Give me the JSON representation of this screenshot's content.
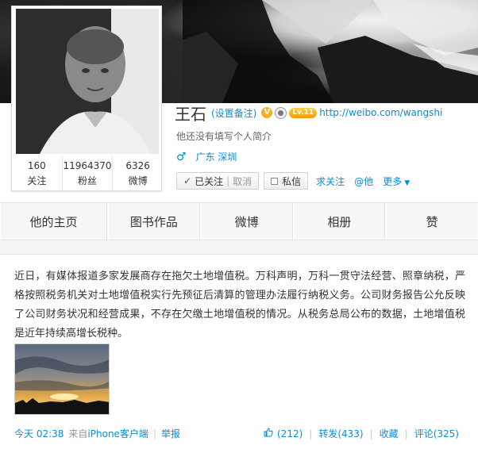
{
  "profile": {
    "name": "王石",
    "remark": "(设置备注)",
    "v_badge": "V",
    "level_badge": "Lv.11",
    "url": "http://weibo.com/wangshi",
    "bio": "他还没有填写个人简介",
    "gender": "♂",
    "location": "广东 深圳",
    "stats": [
      {
        "num": "160",
        "label": "关注"
      },
      {
        "num": "11964370",
        "label": "粉丝"
      },
      {
        "num": "6326",
        "label": "微博"
      }
    ]
  },
  "actions": {
    "check": "✓",
    "followed": "已关注",
    "separator": "|",
    "cancel": "取消",
    "message": "私信",
    "ask": "求关注",
    "at": "@他",
    "more": "更多",
    "more_caret": "▼"
  },
  "tabs": [
    "他的主页",
    "图书作品",
    "微博",
    "相册",
    "赞"
  ],
  "post": {
    "text": "近日，有媒体报道多家发展商存在拖欠土地增值税。万科声明，万科一贯守法经营、照章纳税，严格按照税务机关对土地增值税实行先预征后清算的管理办法履行纳税义务。公司财务报告公允反映了公司财务状况和经营成果，不存在欠缴土地增值税的情况。从税务总局公布的数据，土地增值税是近年持续高增长税种。",
    "time": "今天 02:38",
    "source_prefix": "来自",
    "source": "iPhone客户端",
    "report": "举报",
    "like_icon": "thumbs-up-icon",
    "like_count": "(212)",
    "repost": "转发(433)",
    "favorite": "收藏",
    "comment": "评论(325)",
    "pipe": "|"
  },
  "colors": {
    "link": "#0a8cd2",
    "text": "#333333",
    "muted": "#999999",
    "badge_gold": "#f5b025"
  }
}
